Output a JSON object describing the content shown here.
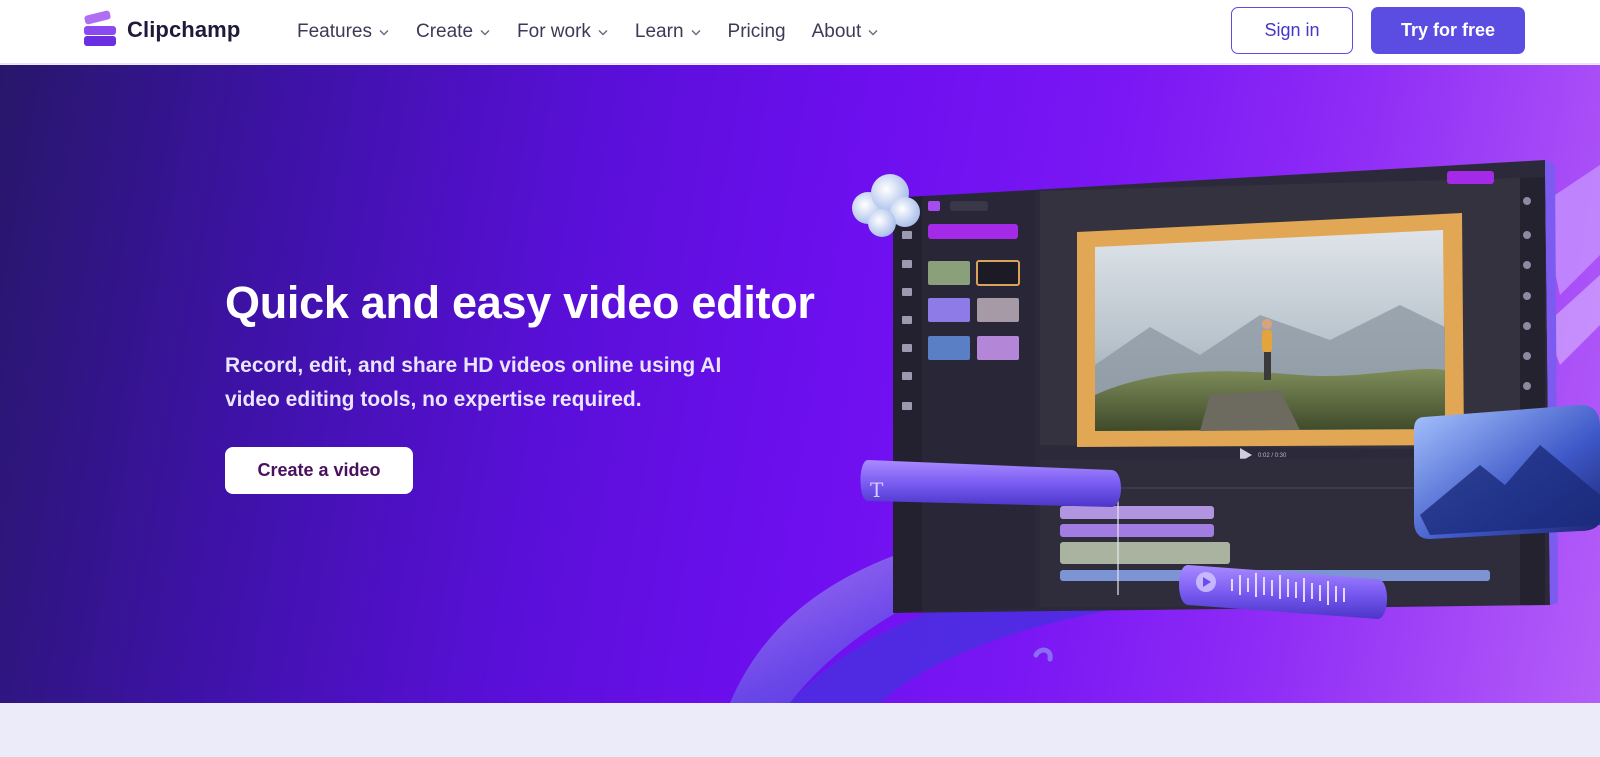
{
  "brand": {
    "name": "Clipchamp"
  },
  "nav": {
    "items": [
      {
        "label": "Features",
        "has_menu": true
      },
      {
        "label": "Create",
        "has_menu": true
      },
      {
        "label": "For work",
        "has_menu": true
      },
      {
        "label": "Learn",
        "has_menu": true
      },
      {
        "label": "Pricing",
        "has_menu": false
      },
      {
        "label": "About",
        "has_menu": true
      }
    ]
  },
  "header": {
    "sign_in_label": "Sign in",
    "try_label": "Try for free"
  },
  "hero": {
    "title": "Quick and easy video editor",
    "subtitle": "Record, edit, and share HD videos online using AI video editing tools, no expertise required.",
    "cta_label": "Create a video"
  },
  "editor_mock": {
    "playback_time": "0:02 / 0:30"
  },
  "colors": {
    "accent": "#5b4de2",
    "hero_start": "#27176a",
    "hero_end": "#b45ef8",
    "cta_text": "#4a0f5e"
  }
}
